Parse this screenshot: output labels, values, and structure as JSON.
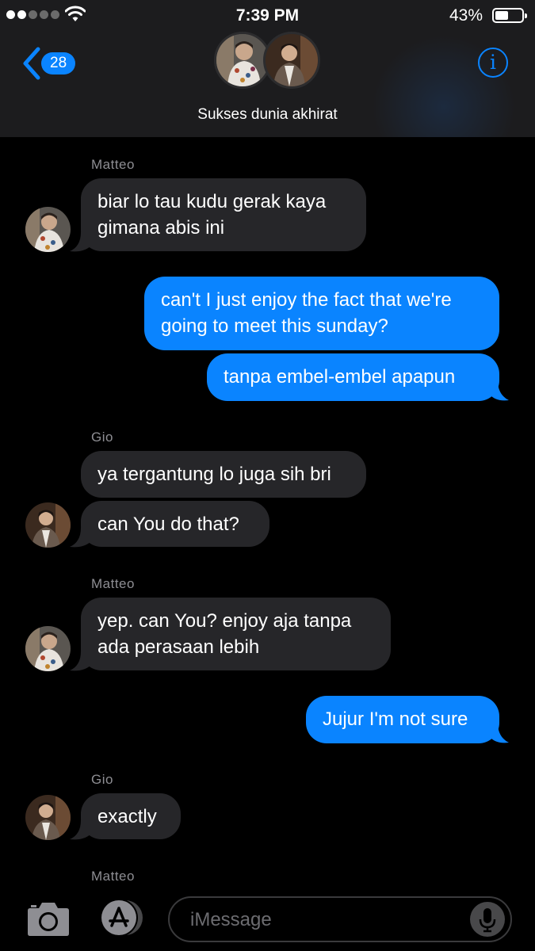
{
  "status_bar": {
    "time": "7:39 PM",
    "battery": "43%"
  },
  "nav": {
    "back_badge": "28",
    "group_name": "Sukses dunia akhirat",
    "info_label": "i"
  },
  "thread": {
    "sender_matteo_1": "Matteo",
    "msg1a": "biar lo tau kudu gerak kaya",
    "msg1b": "gimana abis ini",
    "msg2a": "can't I just enjoy the fact that we're",
    "msg2b": "going to meet this sunday?",
    "msg3": "tanpa embel-embel apapun",
    "sender_gio_1": "Gio",
    "msg4": "ya tergantung lo juga sih bri",
    "msg5": "can You do that?",
    "sender_matteo_2": "Matteo",
    "msg6a": "yep. can You? enjoy aja tanpa",
    "msg6b": "ada perasaan lebih",
    "msg7": "Jujur I'm not sure",
    "sender_gio_2": "Gio",
    "msg8": "exactly",
    "sender_matteo_3": "Matteo"
  },
  "input": {
    "placeholder": "iMessage"
  },
  "icons": [
    "back-chevron-icon",
    "info-icon",
    "camera-icon",
    "app-store-icon",
    "microphone-icon",
    "wifi-icon"
  ],
  "colors": {
    "accent": "#0a84ff",
    "incoming_bubble": "#262629",
    "background": "#000000",
    "bar": "#1c1c1e"
  }
}
